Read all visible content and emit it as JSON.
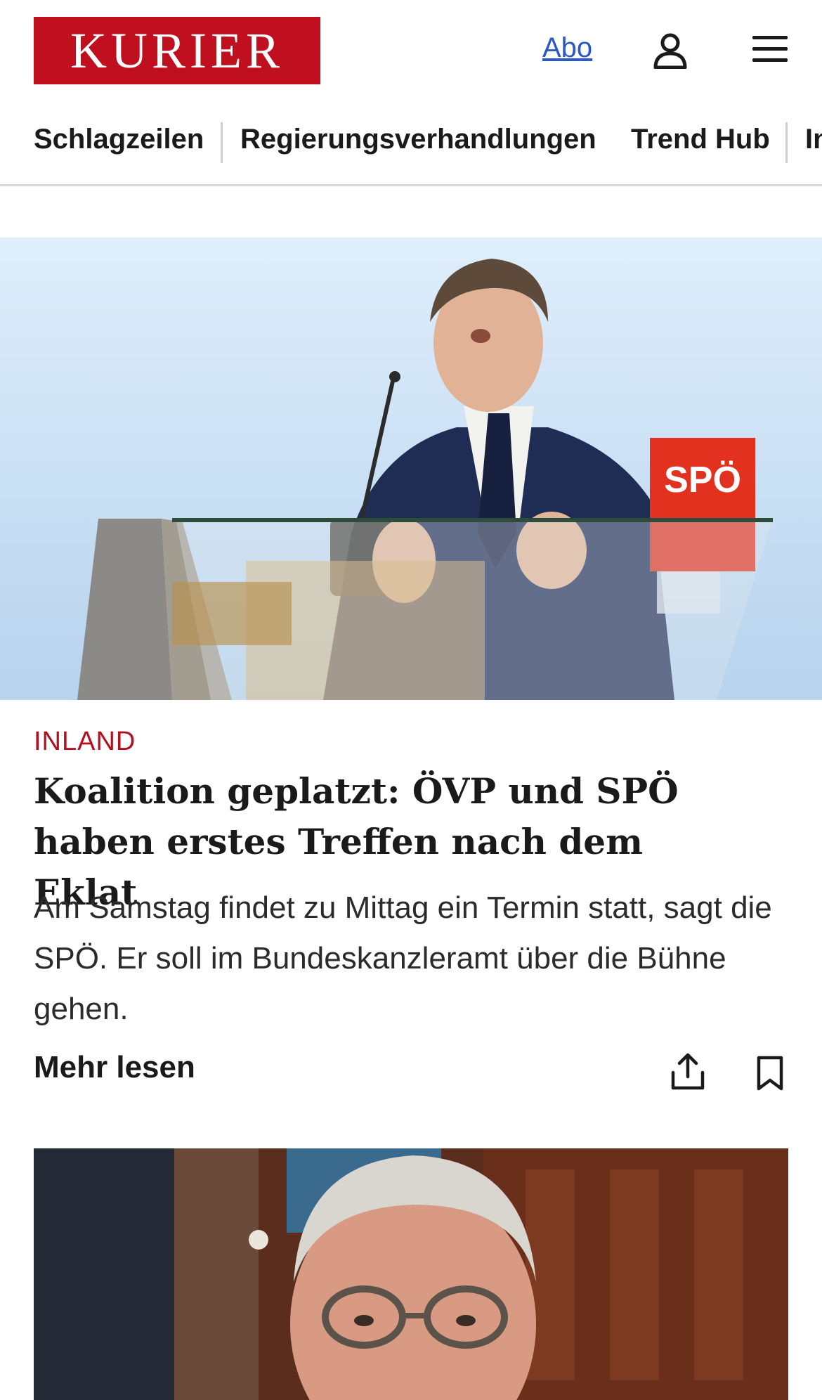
{
  "header": {
    "logo_text": "KURIER",
    "abo_label": "Abo",
    "user_icon": "user-icon",
    "menu_icon": "hamburger-menu-icon"
  },
  "nav": {
    "items": [
      {
        "label": "Schlagzeilen"
      },
      {
        "label": "Regierungsverhandlungen"
      },
      {
        "label": "Trend Hub"
      },
      {
        "label": "In"
      }
    ]
  },
  "article1": {
    "image_sign_text": "SPÖ",
    "category": "INLAND",
    "headline": "Koalition geplatzt: ÖVP und SPÖ haben erstes Treffen nach dem Eklat",
    "teaser": "Am Samstag findet zu Mittag ein Termin statt, sagt die SPÖ. Er soll im Bundeskanzleramt über die Bühne gehen.",
    "more_label": "Mehr lesen",
    "share_icon": "share-icon",
    "bookmark_icon": "bookmark-icon"
  },
  "colors": {
    "brand_red": "#c00f1e",
    "category_red": "#b3101f",
    "link_blue": "#2a57c9"
  }
}
